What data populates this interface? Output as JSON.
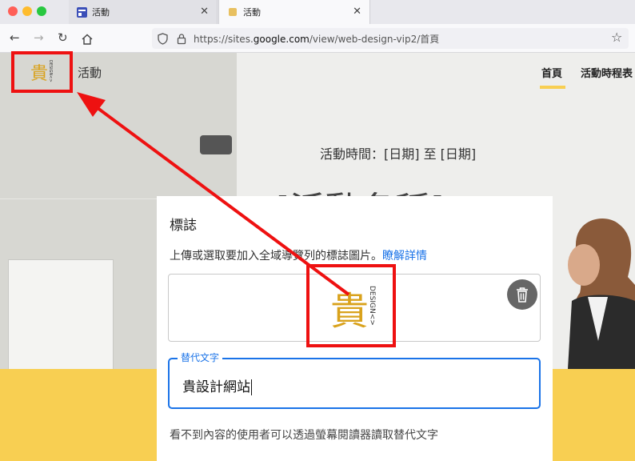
{
  "browser": {
    "tabs": [
      {
        "title": "活動",
        "close": "✕"
      },
      {
        "title": "活動",
        "close": "✕"
      }
    ],
    "url_prefix": "https://sites.",
    "url_domain": "google.com",
    "url_path": "/view/web-design-vip2/首頁"
  },
  "site": {
    "title": "活動",
    "nav": [
      "首頁",
      "活動時程表"
    ],
    "event_time": "活動時間：[日期] 至 [日期]",
    "big_title": "[活動名稱]"
  },
  "dialog": {
    "title": "標誌",
    "description": "上傳或選取要加入全域導覽列的標誌圖片。",
    "link": "瞭解詳情",
    "alt_label": "替代文字",
    "alt_value": "貴設計網站",
    "hint": "看不到內容的使用者可以透過螢幕閱讀器讀取替代文字"
  },
  "logo": {
    "glyph": "貴",
    "side_text": "DESIGN<>"
  },
  "colors": {
    "logo_gold": "#d9a21c",
    "accent_yellow": "#f8cf52",
    "link_blue": "#1a73e8",
    "annotation_red": "#ee1111"
  }
}
